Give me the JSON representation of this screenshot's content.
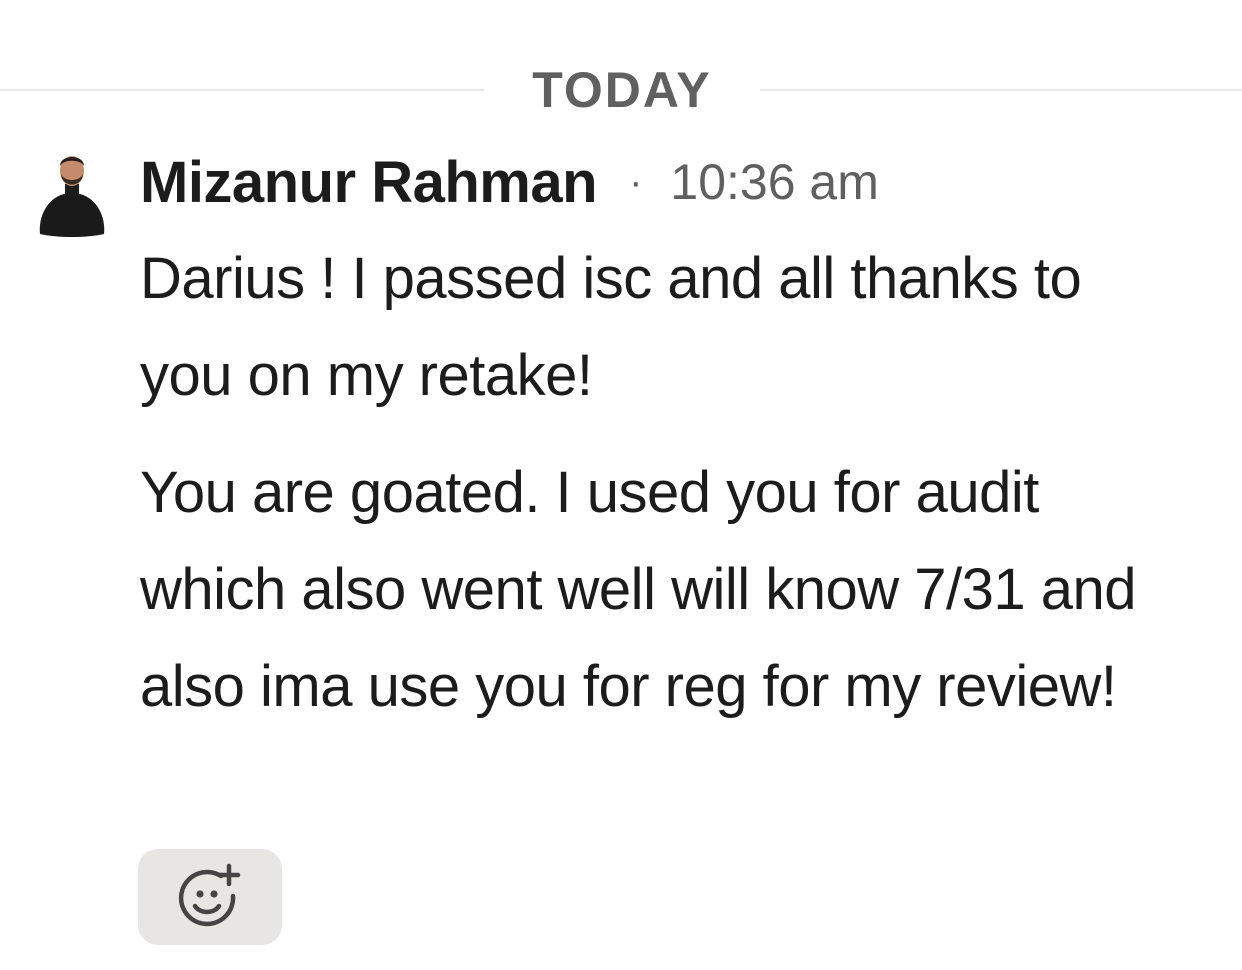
{
  "divider": {
    "label": "TODAY"
  },
  "message": {
    "sender": "Mizanur Rahman",
    "separator": "·",
    "timestamp": "10:36 am",
    "paragraphs": [
      "Darius ! I passed isc and all thanks to you on my retake!",
      "You are goated. I used you for audit which also went well will know 7/31 and also ima use you for reg for my review!"
    ],
    "avatar_icon": "user-avatar",
    "add_reaction_icon": "add-reaction-icon"
  },
  "colors": {
    "text": "#1d1c1d",
    "muted": "#616061",
    "divider_line": "#e6e6e6",
    "reaction_bg": "#e8e6e3"
  }
}
